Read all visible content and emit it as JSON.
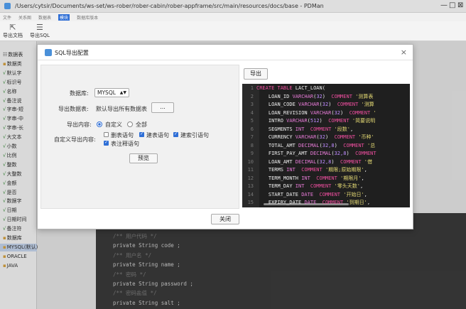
{
  "window": {
    "title": "/Users/cytsir/Documents/ws-set/ws-rober/rober-cabin/rober-appframe/src/main/resources/docs/base - PDMan",
    "controls": [
      "—",
      "□",
      "⊠"
    ]
  },
  "menu": [
    "文件",
    "关系图",
    "数据表",
    "模块",
    "数据库版本"
  ],
  "menu_active_index": 3,
  "toolbar": {
    "export_doc": "导出文档",
    "export_sql": "导出SQL"
  },
  "tree": {
    "items": [
      {
        "label": "数据表",
        "type": "header"
      },
      {
        "label": "数据类",
        "type": "folder"
      },
      {
        "label": "默认字",
        "type": "check"
      },
      {
        "label": "标识号",
        "type": "check"
      },
      {
        "label": "名称",
        "type": "check"
      },
      {
        "label": "备注说",
        "type": "check"
      },
      {
        "label": "字串-短",
        "type": "check"
      },
      {
        "label": "字串-中",
        "type": "check"
      },
      {
        "label": "字串-长",
        "type": "check"
      },
      {
        "label": "大文本",
        "type": "check"
      },
      {
        "label": "小数",
        "type": "check"
      },
      {
        "label": "比例",
        "type": "check"
      },
      {
        "label": "整数",
        "type": "check"
      },
      {
        "label": "大整数",
        "type": "check"
      },
      {
        "label": "金额",
        "type": "check"
      },
      {
        "label": "是否",
        "type": "check"
      },
      {
        "label": "数据字",
        "type": "check"
      },
      {
        "label": "日期",
        "type": "check"
      },
      {
        "label": "日期时间",
        "type": "check"
      },
      {
        "label": "备注符",
        "type": "check"
      },
      {
        "label": "数据库",
        "type": "folder"
      },
      {
        "label": "MYSQL(默认)",
        "type": "db"
      },
      {
        "label": "ORACLE",
        "type": "db"
      },
      {
        "label": "JAVA",
        "type": "db"
      }
    ]
  },
  "editor_lines": [
    {
      "text": "/** 用户代码 */",
      "kind": "cmt"
    },
    {
      "text": "private String code ;",
      "kind": "code"
    },
    {
      "text": "/** 用户名 */",
      "kind": "cmt"
    },
    {
      "text": "private String name ;",
      "kind": "code"
    },
    {
      "text": "/** 密码 */",
      "kind": "cmt"
    },
    {
      "text": "private String password ;",
      "kind": "code"
    },
    {
      "text": "/** 密码盐值 */",
      "kind": "cmt"
    },
    {
      "text": "private String salt ;",
      "kind": "code"
    }
  ],
  "dialog": {
    "title": "SQL导出配置",
    "close_icon": "×",
    "db_label": "数据库:",
    "db_value": "MYSQL",
    "export_table_label": "导出数据表:",
    "export_table_value": "默认导出所有数据表",
    "dots_label": "...",
    "content_label": "导出内容:",
    "radio_custom": "自定义",
    "radio_all": "全部",
    "custom_label": "自定义导出内容:",
    "cb_delete": "删表语句",
    "cb_create": "建表语句",
    "cb_index": "建索引语句",
    "cb_comment": "表注释语句",
    "preview_label": "预览",
    "export_label": "导出",
    "close_label": "关闭",
    "radio_selected": "custom",
    "checks": {
      "delete": false,
      "create": true,
      "index": true,
      "comment": true
    }
  },
  "sql_lines": [
    {
      "n": "1",
      "parts": [
        {
          "t": "CREATE TABLE ",
          "c": "t-kw"
        },
        {
          "t": "LACT_LOAN(",
          "c": "t-white"
        }
      ]
    },
    {
      "n": "2",
      "parts": [
        {
          "t": "    LOAN_ID ",
          "c": "t-white"
        },
        {
          "t": "VARCHAR",
          "c": "t-type"
        },
        {
          "t": "(",
          "c": "t-white"
        },
        {
          "t": "32",
          "c": "t-num"
        },
        {
          "t": ")  ",
          "c": "t-white"
        },
        {
          "t": "COMMENT ",
          "c": "t-kw"
        },
        {
          "t": "'测算表",
          "c": "t-str"
        }
      ]
    },
    {
      "n": "3",
      "parts": [
        {
          "t": "    LOAN_CODE ",
          "c": "t-white"
        },
        {
          "t": "VARCHAR",
          "c": "t-type"
        },
        {
          "t": "(",
          "c": "t-white"
        },
        {
          "t": "32",
          "c": "t-num"
        },
        {
          "t": ")  ",
          "c": "t-white"
        },
        {
          "t": "COMMENT ",
          "c": "t-kw"
        },
        {
          "t": "'测算",
          "c": "t-str"
        }
      ]
    },
    {
      "n": "4",
      "parts": [
        {
          "t": "    LOAN_REVISION ",
          "c": "t-white"
        },
        {
          "t": "VARCHAR",
          "c": "t-type"
        },
        {
          "t": "(",
          "c": "t-white"
        },
        {
          "t": "32",
          "c": "t-num"
        },
        {
          "t": ")  ",
          "c": "t-white"
        },
        {
          "t": "COMMENT ",
          "c": "t-kw"
        },
        {
          "t": "'",
          "c": "t-str"
        }
      ]
    },
    {
      "n": "5",
      "parts": [
        {
          "t": "    INTRO ",
          "c": "t-white"
        },
        {
          "t": "VARCHAR",
          "c": "t-type"
        },
        {
          "t": "(",
          "c": "t-white"
        },
        {
          "t": "512",
          "c": "t-num"
        },
        {
          "t": ")  ",
          "c": "t-white"
        },
        {
          "t": "COMMENT ",
          "c": "t-kw"
        },
        {
          "t": "'简要说明",
          "c": "t-str"
        }
      ]
    },
    {
      "n": "6",
      "parts": [
        {
          "t": "    SEGMENTS ",
          "c": "t-white"
        },
        {
          "t": "INT  ",
          "c": "t-type"
        },
        {
          "t": "COMMENT ",
          "c": "t-kw"
        },
        {
          "t": "'段数'",
          "c": "t-str"
        },
        {
          "t": ",",
          "c": "t-white"
        }
      ]
    },
    {
      "n": "7",
      "parts": [
        {
          "t": "    CURRENCY ",
          "c": "t-white"
        },
        {
          "t": "VARCHAR",
          "c": "t-type"
        },
        {
          "t": "(",
          "c": "t-white"
        },
        {
          "t": "32",
          "c": "t-num"
        },
        {
          "t": ")  ",
          "c": "t-white"
        },
        {
          "t": "COMMENT ",
          "c": "t-kw"
        },
        {
          "t": "'币种'",
          "c": "t-str"
        }
      ]
    },
    {
      "n": "8",
      "parts": [
        {
          "t": "    TOTAL_AMT ",
          "c": "t-white"
        },
        {
          "t": "DECIMAL",
          "c": "t-type"
        },
        {
          "t": "(",
          "c": "t-white"
        },
        {
          "t": "32,8",
          "c": "t-num"
        },
        {
          "t": ")  ",
          "c": "t-white"
        },
        {
          "t": "COMMENT ",
          "c": "t-kw"
        },
        {
          "t": "'总",
          "c": "t-str"
        }
      ]
    },
    {
      "n": "9",
      "parts": [
        {
          "t": "    FIRST_PAY_AMT ",
          "c": "t-white"
        },
        {
          "t": "DECIMAL",
          "c": "t-type"
        },
        {
          "t": "(",
          "c": "t-white"
        },
        {
          "t": "32,8",
          "c": "t-num"
        },
        {
          "t": ")  ",
          "c": "t-white"
        },
        {
          "t": "COMMENT",
          "c": "t-kw"
        }
      ]
    },
    {
      "n": "10",
      "parts": [
        {
          "t": "    LOAN_AMT ",
          "c": "t-white"
        },
        {
          "t": "DECIMAL",
          "c": "t-type"
        },
        {
          "t": "(",
          "c": "t-white"
        },
        {
          "t": "32,8",
          "c": "t-num"
        },
        {
          "t": ")  ",
          "c": "t-white"
        },
        {
          "t": "COMMENT ",
          "c": "t-kw"
        },
        {
          "t": "'借",
          "c": "t-str"
        }
      ]
    },
    {
      "n": "11",
      "parts": [
        {
          "t": "    TERMS ",
          "c": "t-white"
        },
        {
          "t": "INT  ",
          "c": "t-type"
        },
        {
          "t": "COMMENT ",
          "c": "t-kw"
        },
        {
          "t": "'期限;原始期限'",
          "c": "t-str"
        },
        {
          "t": ",",
          "c": "t-white"
        }
      ]
    },
    {
      "n": "12",
      "parts": [
        {
          "t": "    TERM_MONTH ",
          "c": "t-white"
        },
        {
          "t": "INT  ",
          "c": "t-type"
        },
        {
          "t": "COMMENT ",
          "c": "t-kw"
        },
        {
          "t": "'期限月'",
          "c": "t-str"
        },
        {
          "t": ",",
          "c": "t-white"
        }
      ]
    },
    {
      "n": "13",
      "parts": [
        {
          "t": "    TERM_DAY ",
          "c": "t-white"
        },
        {
          "t": "INT  ",
          "c": "t-type"
        },
        {
          "t": "COMMENT ",
          "c": "t-kw"
        },
        {
          "t": "'零头天数'",
          "c": "t-str"
        },
        {
          "t": ",",
          "c": "t-white"
        }
      ]
    },
    {
      "n": "14",
      "parts": [
        {
          "t": "    START_DATE ",
          "c": "t-white"
        },
        {
          "t": "DATE  ",
          "c": "t-type"
        },
        {
          "t": "COMMENT ",
          "c": "t-kw"
        },
        {
          "t": "'开始日'",
          "c": "t-str"
        },
        {
          "t": ",",
          "c": "t-white"
        }
      ]
    },
    {
      "n": "15",
      "parts": [
        {
          "t": "    EXPIRY_DATE ",
          "c": "t-white"
        },
        {
          "t": "DATE  ",
          "c": "t-type"
        },
        {
          "t": "COMMENT ",
          "c": "t-kw"
        },
        {
          "t": "'到期日'",
          "c": "t-str"
        },
        {
          "t": ",",
          "c": "t-white"
        }
      ]
    },
    {
      "n": "16",
      "parts": []
    }
  ]
}
